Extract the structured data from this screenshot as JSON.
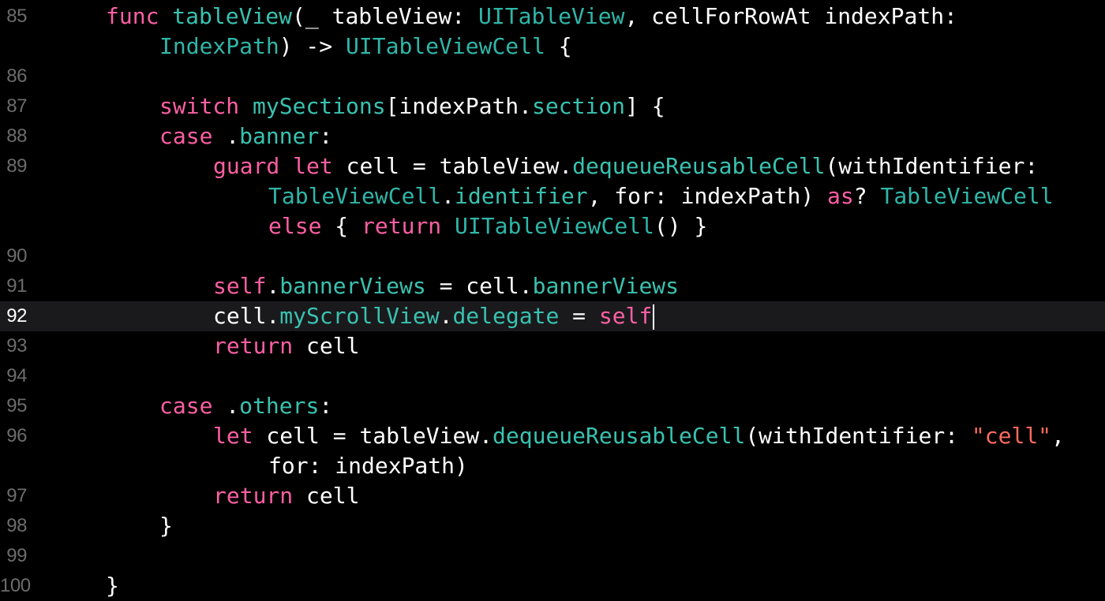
{
  "lines": [
    {
      "number": "85",
      "tokens": [
        {
          "t": "func",
          "c": "kw"
        },
        {
          "t": " "
        },
        {
          "t": "tableView",
          "c": "mem"
        },
        {
          "t": "(_ tableView: "
        },
        {
          "t": "UITableView",
          "c": "tyu"
        },
        {
          "t": ", cellForRowAt indexPath:"
        }
      ]
    },
    {
      "number": "",
      "tokens": [
        {
          "t": "IndexPath",
          "c": "tyu"
        },
        {
          "t": ") -> "
        },
        {
          "t": "UITableViewCell",
          "c": "tyu"
        },
        {
          "t": " {"
        }
      ]
    },
    {
      "number": "86",
      "tokens": []
    },
    {
      "number": "87",
      "tokens": [
        {
          "t": "switch",
          "c": "kw"
        },
        {
          "t": " "
        },
        {
          "t": "mySections",
          "c": "mem"
        },
        {
          "t": "[indexPath."
        },
        {
          "t": "section",
          "c": "mem"
        },
        {
          "t": "] {"
        }
      ]
    },
    {
      "number": "88",
      "tokens": [
        {
          "t": "case",
          "c": "kw"
        },
        {
          "t": " ."
        },
        {
          "t": "banner",
          "c": "mem"
        },
        {
          "t": ":"
        }
      ]
    },
    {
      "number": "89",
      "tokens": [
        {
          "t": "guard",
          "c": "kw"
        },
        {
          "t": " "
        },
        {
          "t": "let",
          "c": "kw"
        },
        {
          "t": " cell = tableView."
        },
        {
          "t": "dequeueReusableCell",
          "c": "mem"
        },
        {
          "t": "(withIdentifier:"
        }
      ]
    },
    {
      "number": "",
      "tokens": [
        {
          "t": "TableViewCell",
          "c": "tyu"
        },
        {
          "t": "."
        },
        {
          "t": "identifier",
          "c": "mem"
        },
        {
          "t": ", for: indexPath) "
        },
        {
          "t": "as",
          "c": "kw"
        },
        {
          "t": "? "
        },
        {
          "t": "TableViewCell",
          "c": "tyu"
        }
      ]
    },
    {
      "number": "",
      "tokens": [
        {
          "t": "else",
          "c": "kw"
        },
        {
          "t": " { "
        },
        {
          "t": "return",
          "c": "kw"
        },
        {
          "t": " "
        },
        {
          "t": "UITableViewCell",
          "c": "tyu"
        },
        {
          "t": "() }"
        }
      ]
    },
    {
      "number": "90",
      "tokens": []
    },
    {
      "number": "91",
      "tokens": [
        {
          "t": "self",
          "c": "kw"
        },
        {
          "t": "."
        },
        {
          "t": "bannerViews",
          "c": "mem"
        },
        {
          "t": " = cell."
        },
        {
          "t": "bannerViews",
          "c": "mem"
        }
      ]
    },
    {
      "number": "92",
      "current": true,
      "tokens": [
        {
          "t": "cell."
        },
        {
          "t": "myScrollView",
          "c": "mem"
        },
        {
          "t": "."
        },
        {
          "t": "delegate",
          "c": "mem"
        },
        {
          "t": " = "
        },
        {
          "t": "self",
          "c": "kw"
        }
      ]
    },
    {
      "number": "93",
      "tokens": [
        {
          "t": "return",
          "c": "kw"
        },
        {
          "t": " cell"
        }
      ]
    },
    {
      "number": "94",
      "tokens": []
    },
    {
      "number": "95",
      "tokens": [
        {
          "t": "case",
          "c": "kw"
        },
        {
          "t": " ."
        },
        {
          "t": "others",
          "c": "mem"
        },
        {
          "t": ":"
        }
      ]
    },
    {
      "number": "96",
      "tokens": [
        {
          "t": "let",
          "c": "kw"
        },
        {
          "t": " cell = tableView."
        },
        {
          "t": "dequeueReusableCell",
          "c": "mem"
        },
        {
          "t": "(withIdentifier: "
        },
        {
          "t": "\"cell\"",
          "c": "str"
        },
        {
          "t": ","
        }
      ]
    },
    {
      "number": "",
      "tokens": [
        {
          "t": "for: indexPath)"
        }
      ]
    },
    {
      "number": "97",
      "tokens": [
        {
          "t": "return",
          "c": "kw"
        },
        {
          "t": " cell"
        }
      ]
    },
    {
      "number": "98",
      "tokens": [
        {
          "t": "}"
        }
      ]
    },
    {
      "number": "99",
      "tokens": []
    },
    {
      "number": "100",
      "tokens": [
        {
          "t": "}"
        }
      ]
    }
  ]
}
